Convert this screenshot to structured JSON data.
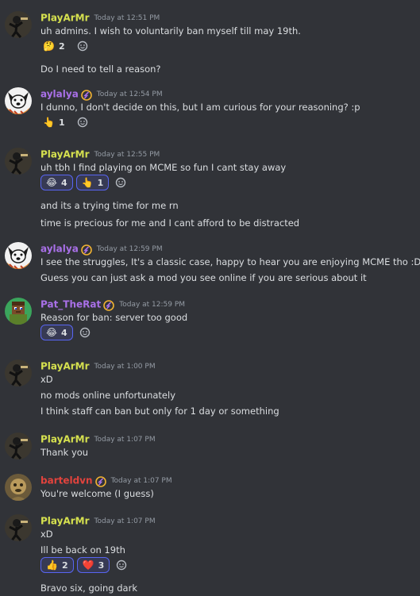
{
  "messages": [
    {
      "author": "PlayArMr",
      "name_color": "#d6e14f",
      "timestamp": "Today at 12:51 PM",
      "avatar": "stickman-avatar",
      "badge": false,
      "lines": [
        "uh admins. I wish to voluntarily ban myself till may 19th."
      ],
      "reactions": [
        {
          "emoji": "🤔",
          "count": "2",
          "mine": false
        }
      ],
      "after": [
        "Do I need to tell a reason?"
      ]
    },
    {
      "author": "aylalya",
      "name_color": "#a970e8",
      "timestamp": "Today at 12:54 PM",
      "avatar": "dog-avatar",
      "badge": true,
      "lines": [
        "I dunno, I don't decide on this, but I am curious for your reasoning? :p"
      ],
      "reactions": [
        {
          "emoji": "👆",
          "count": "1",
          "mine": false
        }
      ],
      "after": []
    },
    {
      "author": "PlayArMr",
      "name_color": "#d6e14f",
      "timestamp": "Today at 12:55 PM",
      "avatar": "stickman-avatar",
      "badge": false,
      "lines": [
        "uh tbh I find playing on MCME so fun I cant stay away"
      ],
      "reactions": [
        {
          "emoji": "😂",
          "count": "4",
          "mine": true
        },
        {
          "emoji": "👆",
          "count": "1",
          "mine": true
        }
      ],
      "after": [
        "and its a trying time for me rn",
        "time is precious for me and I cant afford to be distracted"
      ]
    },
    {
      "author": "aylalya",
      "name_color": "#a970e8",
      "timestamp": "Today at 12:59 PM",
      "avatar": "dog-avatar",
      "badge": true,
      "lines": [
        "I see the struggles, It's a classic case, happy to hear you are enjoying MCME tho :D",
        "Guess you can just ask a mod you see online if you are serious about it"
      ],
      "reactions": [],
      "after": []
    },
    {
      "author": "Pat_TheRat",
      "name_color": "#a970e8",
      "timestamp": "Today at 12:59 PM",
      "avatar": "minecraft-avatar",
      "badge": true,
      "lines": [
        "Reason for ban: server too good"
      ],
      "reactions": [
        {
          "emoji": "😂",
          "count": "4",
          "mine": true
        }
      ],
      "after": []
    },
    {
      "author": "PlayArMr",
      "name_color": "#d6e14f",
      "timestamp": "Today at 1:00 PM",
      "avatar": "stickman-avatar",
      "badge": false,
      "lines": [
        "xD",
        "no mods online unfortunately",
        "I think staff can ban but only for 1 day or something"
      ],
      "reactions": [],
      "after": []
    },
    {
      "author": "PlayArMr",
      "name_color": "#d6e14f",
      "timestamp": "Today at 1:07 PM",
      "avatar": "stickman-avatar",
      "badge": false,
      "lines": [
        "Thank you"
      ],
      "reactions": [],
      "after": []
    },
    {
      "author": "barteldvn",
      "name_color": "#e2433d",
      "timestamp": "Today at 1:07 PM",
      "avatar": "brown-avatar",
      "badge": true,
      "lines": [
        "You're welcome (I guess)"
      ],
      "reactions": [],
      "after": []
    },
    {
      "author": "PlayArMr",
      "name_color": "#d6e14f",
      "timestamp": "Today at 1:07 PM",
      "avatar": "stickman-avatar",
      "badge": false,
      "lines": [
        "xD",
        "Ill be back on 19th"
      ],
      "reactions": [
        {
          "emoji": "👍",
          "count": "2",
          "mine": true
        },
        {
          "emoji": "❤️",
          "count": "3",
          "mine": true
        }
      ],
      "after": [
        "Bravo six, going dark"
      ]
    }
  ],
  "icons": {
    "add_reaction": "add-reaction-icon",
    "badge": "hypesquad-badge-icon"
  }
}
